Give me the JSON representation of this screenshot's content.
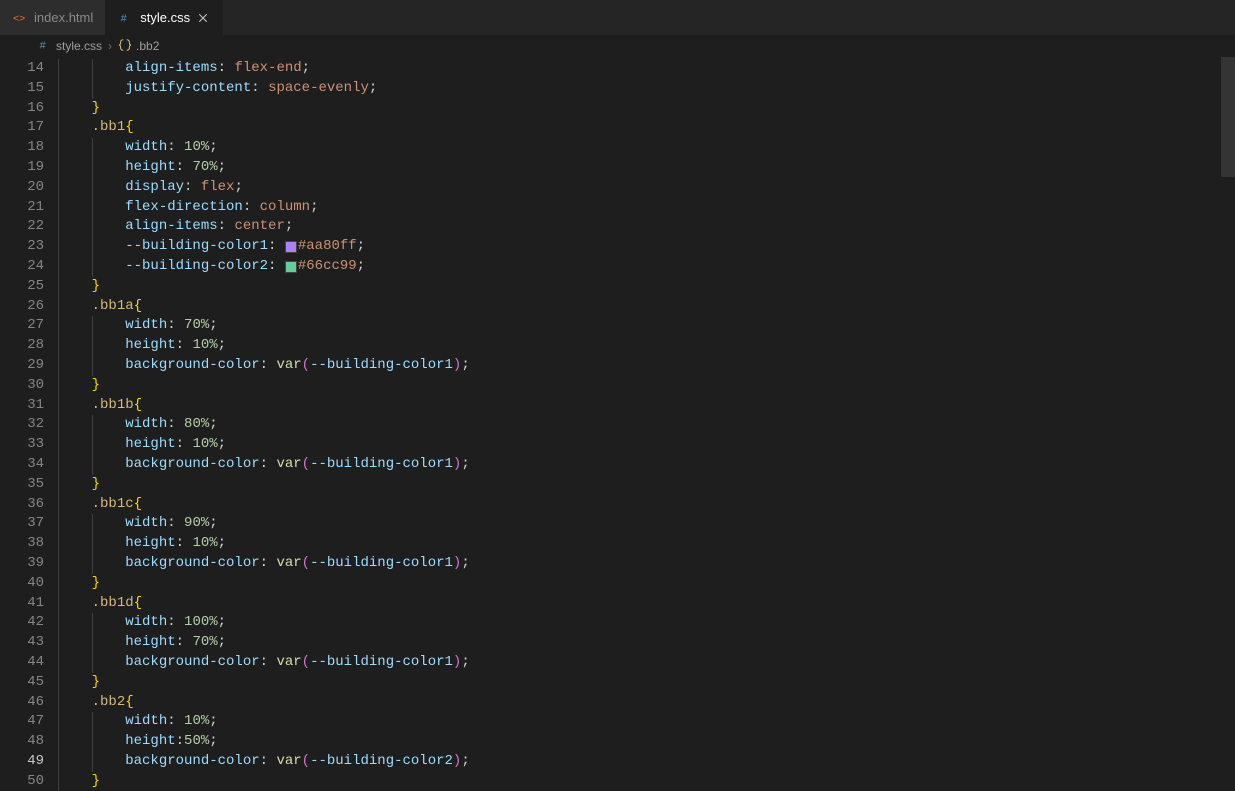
{
  "tabs": [
    {
      "label": "index.html",
      "icon": "html-file-icon",
      "iconColor": "#e37933",
      "active": false
    },
    {
      "label": "style.css",
      "icon": "css-file-icon",
      "iconColor": "#519aba",
      "active": true
    }
  ],
  "breadcrumbs": {
    "file": {
      "label": "style.css",
      "icon": "css-file-icon",
      "iconColor": "#519aba"
    },
    "symbol": {
      "label": ".bb2",
      "icon": "css-rule-icon",
      "iconColor": "#d7ba7d"
    },
    "separator": "›"
  },
  "editor": {
    "firstLineNumber": 14,
    "lastLineNumber": 50,
    "activeLine": 49,
    "lines": [
      {
        "n": 14,
        "indent": 2,
        "tokens": [
          [
            "prop",
            "align-items"
          ],
          [
            "colon",
            ": "
          ],
          [
            "val",
            "flex-end"
          ],
          [
            "semi",
            ";"
          ]
        ]
      },
      {
        "n": 15,
        "indent": 2,
        "tokens": [
          [
            "prop",
            "justify-content"
          ],
          [
            "colon",
            ": "
          ],
          [
            "val",
            "space-evenly"
          ],
          [
            "semi",
            ";"
          ]
        ]
      },
      {
        "n": 16,
        "indent": 1,
        "tokens": [
          [
            "brace-y",
            "}"
          ]
        ]
      },
      {
        "n": 17,
        "indent": 1,
        "tokens": [
          [
            "sel",
            ".bb1"
          ],
          [
            "brace-y",
            "{"
          ]
        ]
      },
      {
        "n": 18,
        "indent": 2,
        "tokens": [
          [
            "prop",
            "width"
          ],
          [
            "colon",
            ": "
          ],
          [
            "num",
            "10%"
          ],
          [
            "semi",
            ";"
          ]
        ]
      },
      {
        "n": 19,
        "indent": 2,
        "tokens": [
          [
            "prop",
            "height"
          ],
          [
            "colon",
            ": "
          ],
          [
            "num",
            "70%"
          ],
          [
            "semi",
            ";"
          ]
        ]
      },
      {
        "n": 20,
        "indent": 2,
        "tokens": [
          [
            "prop",
            "display"
          ],
          [
            "colon",
            ": "
          ],
          [
            "val",
            "flex"
          ],
          [
            "semi",
            ";"
          ]
        ]
      },
      {
        "n": 21,
        "indent": 2,
        "tokens": [
          [
            "prop",
            "flex-direction"
          ],
          [
            "colon",
            ": "
          ],
          [
            "val",
            "column"
          ],
          [
            "semi",
            ";"
          ]
        ]
      },
      {
        "n": 22,
        "indent": 2,
        "tokens": [
          [
            "prop",
            "align-items"
          ],
          [
            "colon",
            ": "
          ],
          [
            "val",
            "center"
          ],
          [
            "semi",
            ";"
          ]
        ]
      },
      {
        "n": 23,
        "indent": 2,
        "tokens": [
          [
            "prop",
            "--building-color1"
          ],
          [
            "colon",
            ": "
          ],
          [
            "swatch",
            "#aa80ff"
          ],
          [
            "val",
            "#aa80ff"
          ],
          [
            "semi",
            ";"
          ]
        ]
      },
      {
        "n": 24,
        "indent": 2,
        "tokens": [
          [
            "prop",
            "--building-color2"
          ],
          [
            "colon",
            ": "
          ],
          [
            "swatch",
            "#66cc99"
          ],
          [
            "val",
            "#66cc99"
          ],
          [
            "semi",
            ";"
          ]
        ]
      },
      {
        "n": 25,
        "indent": 1,
        "tokens": [
          [
            "brace-y",
            "}"
          ]
        ]
      },
      {
        "n": 26,
        "indent": 1,
        "tokens": [
          [
            "sel",
            ".bb1a"
          ],
          [
            "brace-y",
            "{"
          ]
        ]
      },
      {
        "n": 27,
        "indent": 2,
        "tokens": [
          [
            "prop",
            "width"
          ],
          [
            "colon",
            ": "
          ],
          [
            "num",
            "70%"
          ],
          [
            "semi",
            ";"
          ]
        ]
      },
      {
        "n": 28,
        "indent": 2,
        "tokens": [
          [
            "prop",
            "height"
          ],
          [
            "colon",
            ": "
          ],
          [
            "num",
            "10%"
          ],
          [
            "semi",
            ";"
          ]
        ]
      },
      {
        "n": 29,
        "indent": 2,
        "tokens": [
          [
            "prop",
            "background-color"
          ],
          [
            "colon",
            ": "
          ],
          [
            "func",
            "var"
          ],
          [
            "brace-p",
            "("
          ],
          [
            "var",
            "--building-color1"
          ],
          [
            "brace-p",
            ")"
          ],
          [
            "semi",
            ";"
          ]
        ]
      },
      {
        "n": 30,
        "indent": 1,
        "tokens": [
          [
            "brace-y",
            "}"
          ]
        ]
      },
      {
        "n": 31,
        "indent": 1,
        "tokens": [
          [
            "sel",
            ".bb1b"
          ],
          [
            "brace-y",
            "{"
          ]
        ]
      },
      {
        "n": 32,
        "indent": 2,
        "tokens": [
          [
            "prop",
            "width"
          ],
          [
            "colon",
            ": "
          ],
          [
            "num",
            "80%"
          ],
          [
            "semi",
            ";"
          ]
        ]
      },
      {
        "n": 33,
        "indent": 2,
        "tokens": [
          [
            "prop",
            "height"
          ],
          [
            "colon",
            ": "
          ],
          [
            "num",
            "10%"
          ],
          [
            "semi",
            ";"
          ]
        ]
      },
      {
        "n": 34,
        "indent": 2,
        "tokens": [
          [
            "prop",
            "background-color"
          ],
          [
            "colon",
            ": "
          ],
          [
            "func",
            "var"
          ],
          [
            "brace-p",
            "("
          ],
          [
            "var",
            "--building-color1"
          ],
          [
            "brace-p",
            ")"
          ],
          [
            "semi",
            ";"
          ]
        ]
      },
      {
        "n": 35,
        "indent": 1,
        "tokens": [
          [
            "brace-y",
            "}"
          ]
        ]
      },
      {
        "n": 36,
        "indent": 1,
        "tokens": [
          [
            "sel",
            ".bb1c"
          ],
          [
            "brace-y",
            "{"
          ]
        ]
      },
      {
        "n": 37,
        "indent": 2,
        "tokens": [
          [
            "prop",
            "width"
          ],
          [
            "colon",
            ": "
          ],
          [
            "num",
            "90%"
          ],
          [
            "semi",
            ";"
          ]
        ]
      },
      {
        "n": 38,
        "indent": 2,
        "tokens": [
          [
            "prop",
            "height"
          ],
          [
            "colon",
            ": "
          ],
          [
            "num",
            "10%"
          ],
          [
            "semi",
            ";"
          ]
        ]
      },
      {
        "n": 39,
        "indent": 2,
        "tokens": [
          [
            "prop",
            "background-color"
          ],
          [
            "colon",
            ": "
          ],
          [
            "func",
            "var"
          ],
          [
            "brace-p",
            "("
          ],
          [
            "var",
            "--building-color1"
          ],
          [
            "brace-p",
            ")"
          ],
          [
            "semi",
            ";"
          ]
        ]
      },
      {
        "n": 40,
        "indent": 1,
        "tokens": [
          [
            "brace-y",
            "}"
          ]
        ]
      },
      {
        "n": 41,
        "indent": 1,
        "tokens": [
          [
            "sel",
            ".bb1d"
          ],
          [
            "brace-y",
            "{"
          ]
        ]
      },
      {
        "n": 42,
        "indent": 2,
        "tokens": [
          [
            "prop",
            "width"
          ],
          [
            "colon",
            ": "
          ],
          [
            "num",
            "100%"
          ],
          [
            "semi",
            ";"
          ]
        ]
      },
      {
        "n": 43,
        "indent": 2,
        "tokens": [
          [
            "prop",
            "height"
          ],
          [
            "colon",
            ": "
          ],
          [
            "num",
            "70%"
          ],
          [
            "semi",
            ";"
          ]
        ]
      },
      {
        "n": 44,
        "indent": 2,
        "tokens": [
          [
            "prop",
            "background-color"
          ],
          [
            "colon",
            ": "
          ],
          [
            "func",
            "var"
          ],
          [
            "brace-p",
            "("
          ],
          [
            "var",
            "--building-color1"
          ],
          [
            "brace-p",
            ")"
          ],
          [
            "semi",
            ";"
          ]
        ]
      },
      {
        "n": 45,
        "indent": 1,
        "tokens": [
          [
            "brace-y",
            "}"
          ]
        ]
      },
      {
        "n": 46,
        "indent": 1,
        "tokens": [
          [
            "sel",
            ".bb2"
          ],
          [
            "brace-y",
            "{"
          ]
        ]
      },
      {
        "n": 47,
        "indent": 2,
        "tokens": [
          [
            "prop",
            "width"
          ],
          [
            "colon",
            ": "
          ],
          [
            "num",
            "10%"
          ],
          [
            "semi",
            ";"
          ]
        ]
      },
      {
        "n": 48,
        "indent": 2,
        "tokens": [
          [
            "prop",
            "height"
          ],
          [
            "colon",
            ":"
          ],
          [
            "num",
            "50%"
          ],
          [
            "semi",
            ";"
          ]
        ]
      },
      {
        "n": 49,
        "indent": 2,
        "tokens": [
          [
            "prop",
            "background-color"
          ],
          [
            "colon",
            ": "
          ],
          [
            "func",
            "var"
          ],
          [
            "brace-p",
            "("
          ],
          [
            "var",
            "--building-color2"
          ],
          [
            "brace-p",
            ")"
          ],
          [
            "semi",
            ";"
          ]
        ]
      },
      {
        "n": 50,
        "indent": 1,
        "tokens": [
          [
            "brace-y",
            "}"
          ]
        ]
      }
    ]
  }
}
